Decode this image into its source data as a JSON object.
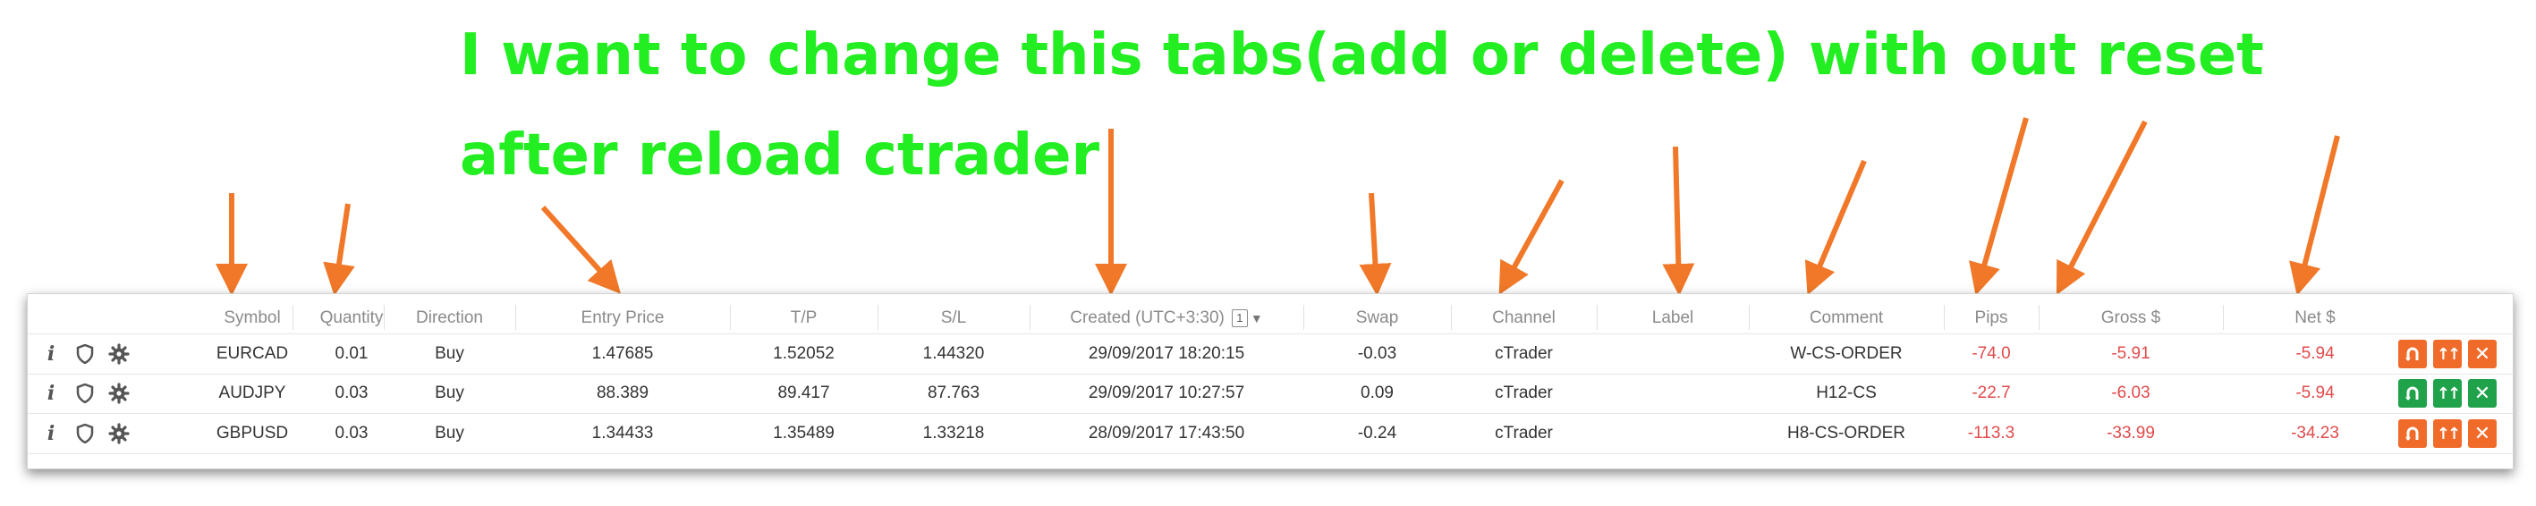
{
  "annotation": {
    "text": "I want to change this tabs(add or delete) with out reset after reload ctrader",
    "color": "#22ee22"
  },
  "arrow_color": "#f07828",
  "positions_table": {
    "columns": {
      "symbol": "Symbol",
      "quantity": "Quantity",
      "direction": "Direction",
      "entry_price": "Entry Price",
      "tp": "T/P",
      "sl": "S/L",
      "created": "Created (UTC+3:30)",
      "created_sort_index": "1",
      "swap": "Swap",
      "channel": "Channel",
      "label": "Label",
      "comment": "Comment",
      "pips": "Pips",
      "gross": "Gross $",
      "net": "Net $"
    },
    "rows": [
      {
        "symbol": "EURCAD",
        "quantity": "0.01",
        "direction": "Buy",
        "entry_price": "1.47685",
        "tp": "1.52052",
        "sl": "1.44320",
        "created": "29/09/2017 18:20:15",
        "swap": "-0.03",
        "channel": "cTrader",
        "label": "",
        "comment": "W-CS-ORDER",
        "pips": "-74.0",
        "gross": "-5.91",
        "net": "-5.94",
        "action_color": "orange"
      },
      {
        "symbol": "AUDJPY",
        "quantity": "0.03",
        "direction": "Buy",
        "entry_price": "88.389",
        "tp": "89.417",
        "sl": "87.763",
        "created": "29/09/2017 10:27:57",
        "swap": "0.09",
        "channel": "cTrader",
        "label": "",
        "comment": "H12-CS",
        "pips": "-22.7",
        "gross": "-6.03",
        "net": "-5.94",
        "action_color": "green"
      },
      {
        "symbol": "GBPUSD",
        "quantity": "0.03",
        "direction": "Buy",
        "entry_price": "1.34433",
        "tp": "1.35489",
        "sl": "1.33218",
        "created": "28/09/2017 17:43:50",
        "swap": "-0.24",
        "channel": "cTrader",
        "label": "",
        "comment": "H8-CS-ORDER",
        "pips": "-113.3",
        "gross": "-33.99",
        "net": "-34.23",
        "action_color": "orange"
      }
    ],
    "row_icons": [
      "info-icon",
      "shield-icon",
      "gear-icon"
    ],
    "action_icons": [
      "reverse-position-icon",
      "double-position-icon",
      "close-position-icon"
    ],
    "colors": {
      "negative": "#e24a4a",
      "orange": "#f06a2a",
      "green": "#1fa24a"
    }
  }
}
